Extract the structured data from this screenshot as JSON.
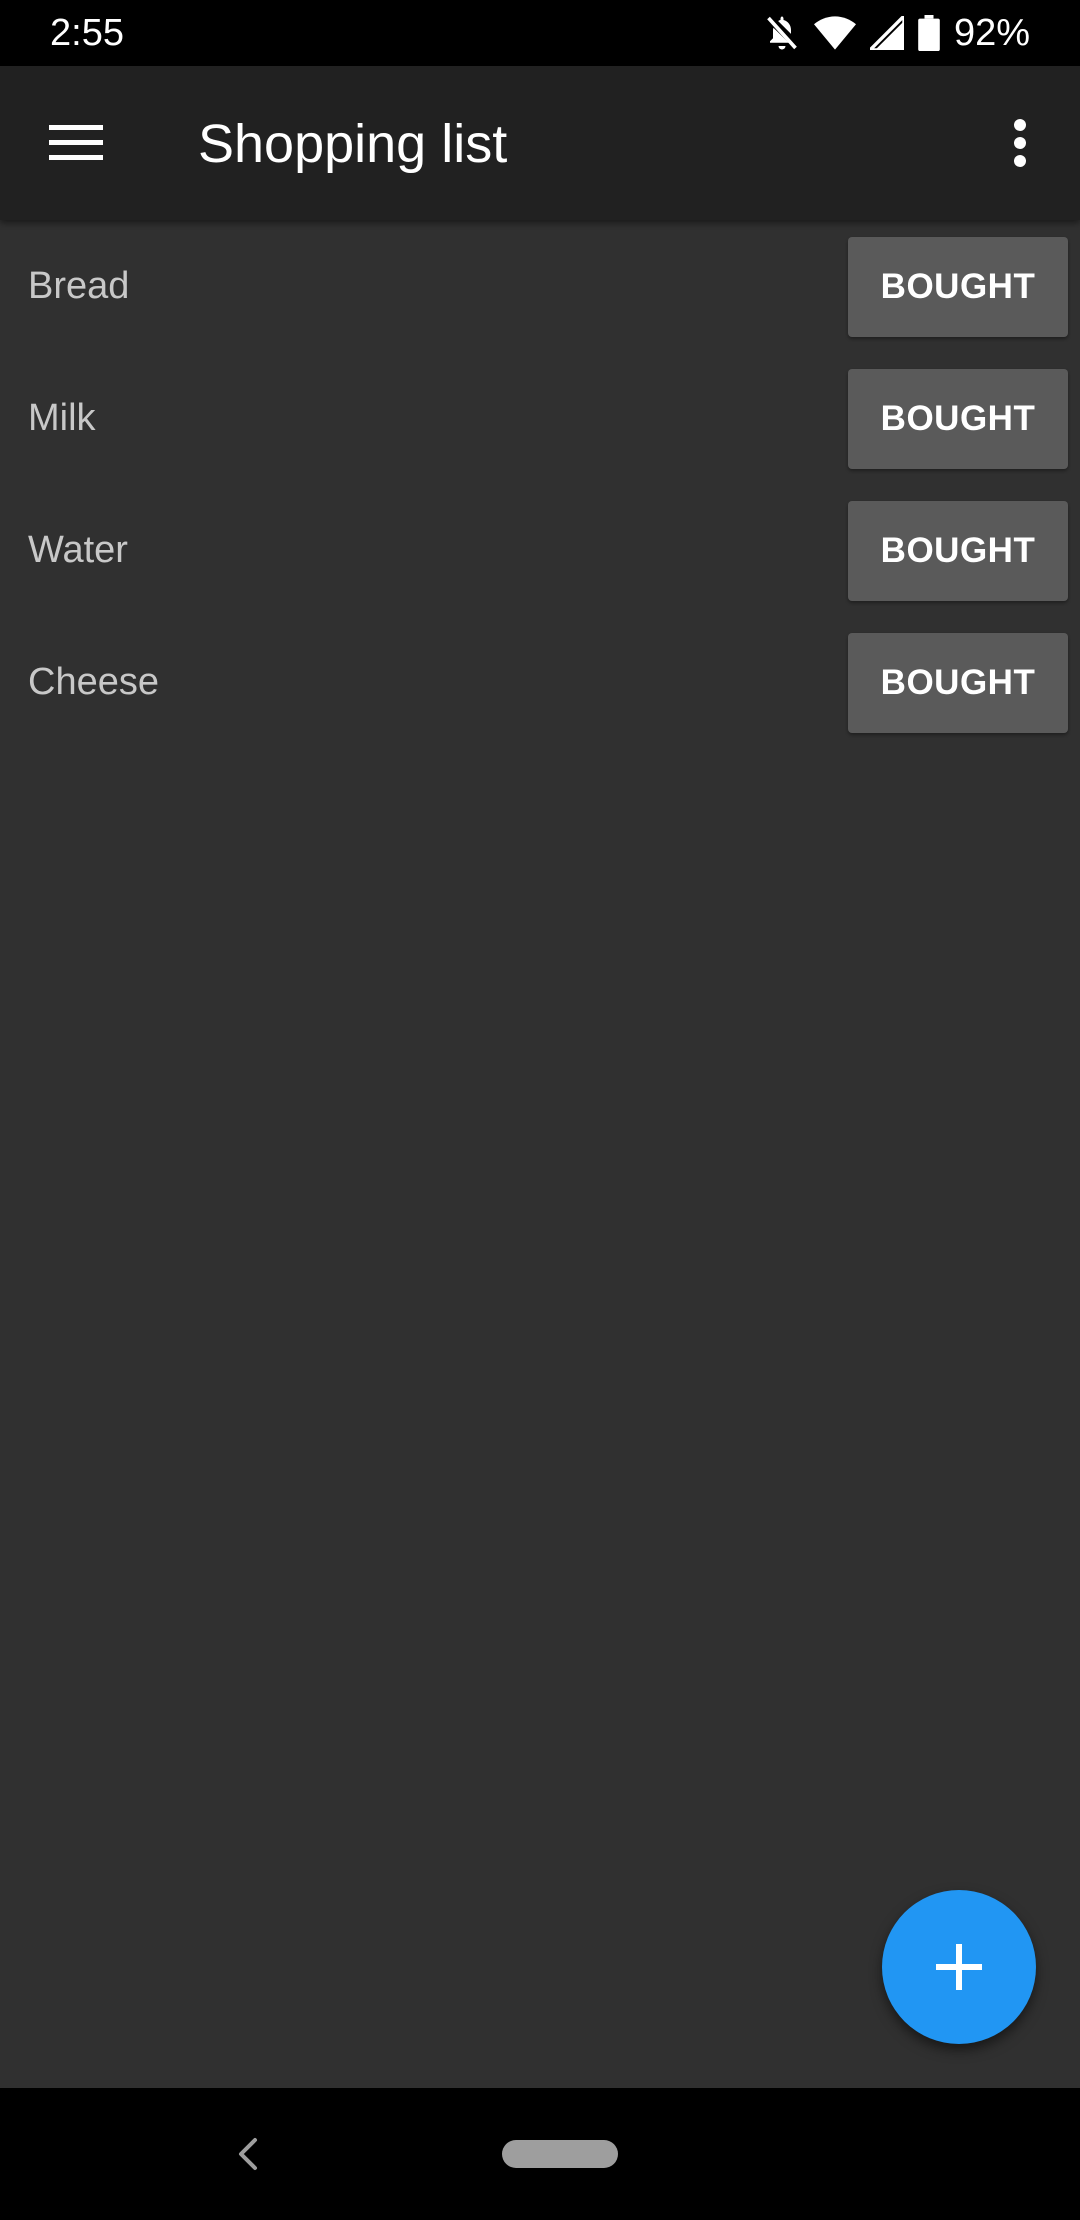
{
  "status_bar": {
    "time": "2:55",
    "battery_percent": "92%",
    "icons": [
      "notifications-off-icon",
      "wifi-icon",
      "cell-signal-icon",
      "battery-icon"
    ]
  },
  "app_bar": {
    "title": "Shopping list",
    "menu_icon": "hamburger-menu-icon",
    "overflow_icon": "more-vert-icon"
  },
  "items": [
    {
      "label": "Bread",
      "button_label": "BOUGHT"
    },
    {
      "label": "Milk",
      "button_label": "BOUGHT"
    },
    {
      "label": "Water",
      "button_label": "BOUGHT"
    },
    {
      "label": "Cheese",
      "button_label": "BOUGHT"
    }
  ],
  "fab": {
    "icon": "plus-icon",
    "color": "#2196F3"
  },
  "nav_bar": {
    "back_icon": "back-chevron-icon",
    "home_icon": "home-pill-icon"
  },
  "colors": {
    "background": "#303030",
    "app_bar": "#212121",
    "button": "#5A5A5A",
    "accent": "#2196F3"
  }
}
